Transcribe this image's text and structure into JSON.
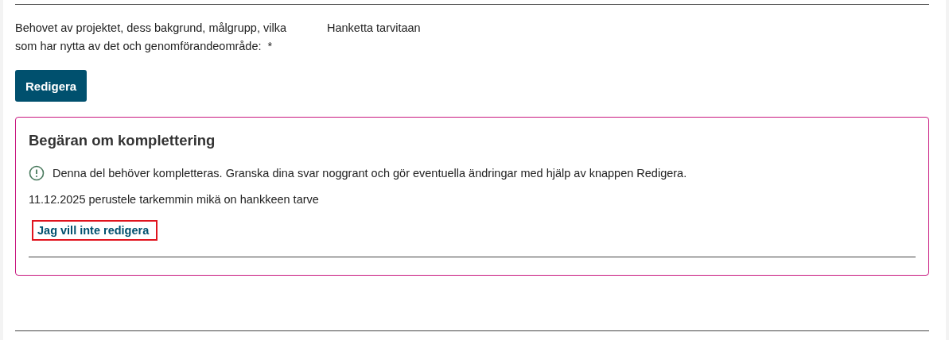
{
  "field": {
    "label": "Behovet av projektet, dess bakgrund, målgrupp, vilka som har nytta av det och genomförandeområde:",
    "required_mark": "*",
    "value": "Hanketta tarvitaan"
  },
  "edit_button": {
    "label": "Redigera"
  },
  "request": {
    "title": "Begäran om komplettering",
    "notice": "Denna del behöver kompletteras. Granska dina svar noggrant och gör eventuella ändringar med hjälp av knappen Redigera.",
    "comment": "11.12.2025 perustele tarkemmin mikä on hankkeen tarve",
    "link": {
      "label": "Jag vill inte redigera",
      "highlighted": true
    }
  }
}
